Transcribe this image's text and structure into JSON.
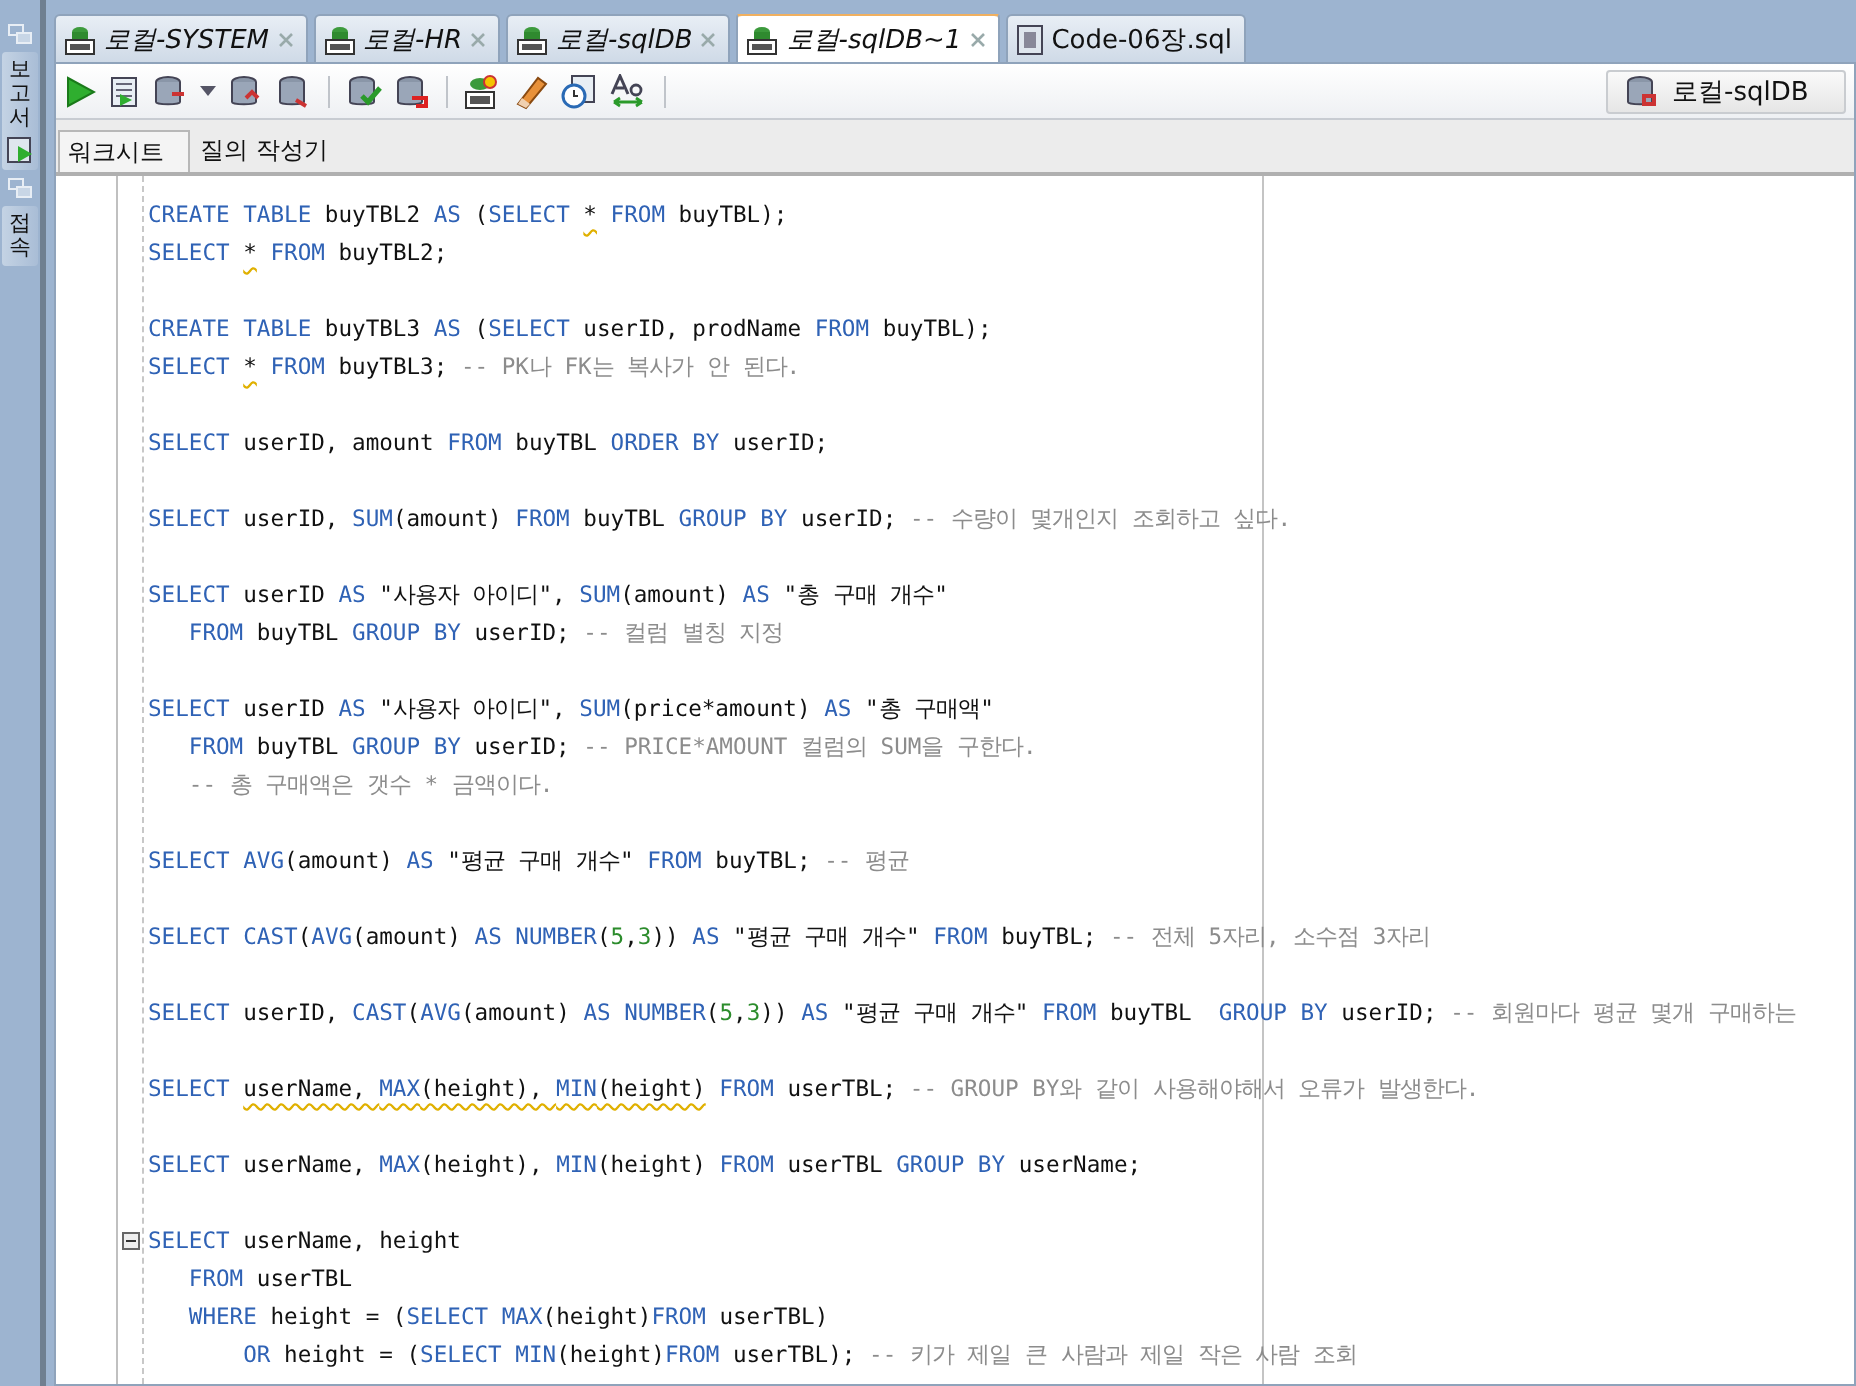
{
  "editor_tabs": [
    {
      "label": "로컬-SYSTEM",
      "selected": false,
      "kind": "worksheet"
    },
    {
      "label": "로컬-HR",
      "selected": false,
      "kind": "worksheet"
    },
    {
      "label": "로컬-sqlDB",
      "selected": false,
      "kind": "worksheet"
    },
    {
      "label": "로컬-sqlDB~1",
      "selected": true,
      "kind": "worksheet"
    },
    {
      "label": "Code-06장.sql",
      "selected": false,
      "kind": "file"
    }
  ],
  "side_tabs": [
    {
      "label": "보고서"
    },
    {
      "label": "접속"
    }
  ],
  "connection": {
    "label": "로컬-sqlDB"
  },
  "sub_tabs": [
    {
      "label": "워크시트",
      "selected": true
    },
    {
      "label": "질의 작성기",
      "selected": false
    }
  ],
  "code_lines": [
    {
      "kind": "code",
      "tokens": [
        {
          "kind": "keyword",
          "text": "CREATE TABLE"
        },
        {
          "kind": "plain",
          "text": " buyTBL2 "
        },
        {
          "kind": "keyword",
          "text": "AS"
        },
        {
          "kind": "plain",
          "text": " ("
        },
        {
          "kind": "keyword",
          "text": "SELECT "
        },
        {
          "kind": "plain",
          "text": "*",
          "squiggle": true
        },
        {
          "kind": "keyword",
          "text": " FROM"
        },
        {
          "kind": "plain",
          "text": " buyTBL);"
        }
      ]
    },
    {
      "kind": "code",
      "tokens": [
        {
          "kind": "keyword",
          "text": "SELECT "
        },
        {
          "kind": "plain",
          "text": "*",
          "squiggle": true
        },
        {
          "kind": "keyword",
          "text": " FROM"
        },
        {
          "kind": "plain",
          "text": " buyTBL2;"
        }
      ]
    },
    {
      "kind": "blank"
    },
    {
      "kind": "code",
      "tokens": [
        {
          "kind": "keyword",
          "text": "CREATE TABLE"
        },
        {
          "kind": "plain",
          "text": " buyTBL3 "
        },
        {
          "kind": "keyword",
          "text": "AS"
        },
        {
          "kind": "plain",
          "text": " ("
        },
        {
          "kind": "keyword",
          "text": "SELECT"
        },
        {
          "kind": "plain",
          "text": " userID, prodName "
        },
        {
          "kind": "keyword",
          "text": "FROM"
        },
        {
          "kind": "plain",
          "text": " buyTBL);"
        }
      ]
    },
    {
      "kind": "code",
      "tokens": [
        {
          "kind": "keyword",
          "text": "SELECT "
        },
        {
          "kind": "plain",
          "text": "*",
          "squiggle": true
        },
        {
          "kind": "keyword",
          "text": " FROM"
        },
        {
          "kind": "plain",
          "text": " buyTBL3; "
        },
        {
          "kind": "comment",
          "text": "-- PK나 FK는 복사가 안 된다."
        }
      ]
    },
    {
      "kind": "blank"
    },
    {
      "kind": "code",
      "tokens": [
        {
          "kind": "keyword",
          "text": "SELECT"
        },
        {
          "kind": "plain",
          "text": " userID, amount "
        },
        {
          "kind": "keyword",
          "text": "FROM"
        },
        {
          "kind": "plain",
          "text": " buyTBL "
        },
        {
          "kind": "keyword",
          "text": "ORDER BY"
        },
        {
          "kind": "plain",
          "text": " userID;"
        }
      ]
    },
    {
      "kind": "blank"
    },
    {
      "kind": "code",
      "tokens": [
        {
          "kind": "keyword",
          "text": "SELECT"
        },
        {
          "kind": "plain",
          "text": " userID, "
        },
        {
          "kind": "keyword",
          "text": "SUM"
        },
        {
          "kind": "plain",
          "text": "(amount) "
        },
        {
          "kind": "keyword",
          "text": "FROM"
        },
        {
          "kind": "plain",
          "text": " buyTBL "
        },
        {
          "kind": "keyword",
          "text": "GROUP BY"
        },
        {
          "kind": "plain",
          "text": " userID; "
        },
        {
          "kind": "comment",
          "text": "-- 수량이 몇개인지 조회하고 싶다."
        }
      ]
    },
    {
      "kind": "blank"
    },
    {
      "kind": "code",
      "tokens": [
        {
          "kind": "keyword",
          "text": "SELECT"
        },
        {
          "kind": "plain",
          "text": " userID "
        },
        {
          "kind": "keyword",
          "text": "AS"
        },
        {
          "kind": "plain",
          "text": " \"사용자 아이디\", "
        },
        {
          "kind": "keyword",
          "text": "SUM"
        },
        {
          "kind": "plain",
          "text": "(amount) "
        },
        {
          "kind": "keyword",
          "text": "AS"
        },
        {
          "kind": "plain",
          "text": " \"총 구매 개수\""
        }
      ]
    },
    {
      "kind": "code",
      "tokens": [
        {
          "kind": "keyword",
          "text": "   FROM"
        },
        {
          "kind": "plain",
          "text": " buyTBL "
        },
        {
          "kind": "keyword",
          "text": "GROUP BY"
        },
        {
          "kind": "plain",
          "text": " userID; "
        },
        {
          "kind": "comment",
          "text": "-- 컬럼 별칭 지정"
        }
      ]
    },
    {
      "kind": "blank"
    },
    {
      "kind": "code",
      "tokens": [
        {
          "kind": "keyword",
          "text": "SELECT"
        },
        {
          "kind": "plain",
          "text": " userID "
        },
        {
          "kind": "keyword",
          "text": "AS"
        },
        {
          "kind": "plain",
          "text": " \"사용자 아이디\", "
        },
        {
          "kind": "keyword",
          "text": "SUM"
        },
        {
          "kind": "plain",
          "text": "(price*amount) "
        },
        {
          "kind": "keyword",
          "text": "AS"
        },
        {
          "kind": "plain",
          "text": " \"총 구매액\""
        }
      ]
    },
    {
      "kind": "code",
      "tokens": [
        {
          "kind": "keyword",
          "text": "   FROM"
        },
        {
          "kind": "plain",
          "text": " buyTBL "
        },
        {
          "kind": "keyword",
          "text": "GROUP BY"
        },
        {
          "kind": "plain",
          "text": " userID; "
        },
        {
          "kind": "comment",
          "text": "-- PRICE*AMOUNT 컬럼의 SUM을 구한다."
        }
      ]
    },
    {
      "kind": "code",
      "tokens": [
        {
          "kind": "comment",
          "text": "   -- 총 구매액은 갯수 * 금액이다."
        }
      ]
    },
    {
      "kind": "blank"
    },
    {
      "kind": "code",
      "tokens": [
        {
          "kind": "keyword",
          "text": "SELECT AVG"
        },
        {
          "kind": "plain",
          "text": "(amount) "
        },
        {
          "kind": "keyword",
          "text": "AS"
        },
        {
          "kind": "plain",
          "text": " \"평균 구매 개수\" "
        },
        {
          "kind": "keyword",
          "text": "FROM"
        },
        {
          "kind": "plain",
          "text": " buyTBL; "
        },
        {
          "kind": "comment",
          "text": "-- 평균"
        }
      ]
    },
    {
      "kind": "blank"
    },
    {
      "kind": "code",
      "tokens": [
        {
          "kind": "keyword",
          "text": "SELECT CAST"
        },
        {
          "kind": "plain",
          "text": "("
        },
        {
          "kind": "keyword",
          "text": "AVG"
        },
        {
          "kind": "plain",
          "text": "(amount) "
        },
        {
          "kind": "keyword",
          "text": "AS NUMBER"
        },
        {
          "kind": "plain",
          "text": "("
        },
        {
          "kind": "number",
          "text": "5"
        },
        {
          "kind": "plain",
          "text": ","
        },
        {
          "kind": "number",
          "text": "3"
        },
        {
          "kind": "plain",
          "text": ")) "
        },
        {
          "kind": "keyword",
          "text": "AS"
        },
        {
          "kind": "plain",
          "text": " \"평균 구매 개수\" "
        },
        {
          "kind": "keyword",
          "text": "FROM"
        },
        {
          "kind": "plain",
          "text": " buyTBL; "
        },
        {
          "kind": "comment",
          "text": "-- 전체 5자리, 소수점 3자리"
        }
      ]
    },
    {
      "kind": "blank"
    },
    {
      "kind": "code",
      "tokens": [
        {
          "kind": "keyword",
          "text": "SELECT"
        },
        {
          "kind": "plain",
          "text": " userID, "
        },
        {
          "kind": "keyword",
          "text": "CAST"
        },
        {
          "kind": "plain",
          "text": "("
        },
        {
          "kind": "keyword",
          "text": "AVG"
        },
        {
          "kind": "plain",
          "text": "(amount) "
        },
        {
          "kind": "keyword",
          "text": "AS NUMBER"
        },
        {
          "kind": "plain",
          "text": "("
        },
        {
          "kind": "number",
          "text": "5"
        },
        {
          "kind": "plain",
          "text": ","
        },
        {
          "kind": "number",
          "text": "3"
        },
        {
          "kind": "plain",
          "text": ")) "
        },
        {
          "kind": "keyword",
          "text": "AS"
        },
        {
          "kind": "plain",
          "text": " \"평균 구매 개수\" "
        },
        {
          "kind": "keyword",
          "text": "FROM"
        },
        {
          "kind": "plain",
          "text": " buyTBL  "
        },
        {
          "kind": "keyword",
          "text": "GROUP BY"
        },
        {
          "kind": "plain",
          "text": " userID; "
        },
        {
          "kind": "comment",
          "text": "-- 회원마다 평균 몇개 구매하는"
        }
      ]
    },
    {
      "kind": "blank"
    },
    {
      "kind": "code",
      "tokens": [
        {
          "kind": "keyword",
          "text": "SELECT "
        },
        {
          "kind": "plain",
          "text": "userName, ",
          "squiggle": true
        },
        {
          "kind": "keyword",
          "text": "MAX",
          "squiggle": true
        },
        {
          "kind": "plain",
          "text": "(height), ",
          "squiggle": true
        },
        {
          "kind": "keyword",
          "text": "MIN",
          "squiggle": true
        },
        {
          "kind": "plain",
          "text": "(height)",
          "squiggle": true
        },
        {
          "kind": "keyword",
          "text": " FROM"
        },
        {
          "kind": "plain",
          "text": " userTBL; "
        },
        {
          "kind": "comment",
          "text": "-- GROUP BY와 같이 사용해야해서 오류가 발생한다."
        }
      ]
    },
    {
      "kind": "blank"
    },
    {
      "kind": "code",
      "tokens": [
        {
          "kind": "keyword",
          "text": "SELECT"
        },
        {
          "kind": "plain",
          "text": " userName, "
        },
        {
          "kind": "keyword",
          "text": "MAX"
        },
        {
          "kind": "plain",
          "text": "(height), "
        },
        {
          "kind": "keyword",
          "text": "MIN"
        },
        {
          "kind": "plain",
          "text": "(height) "
        },
        {
          "kind": "keyword",
          "text": "FROM"
        },
        {
          "kind": "plain",
          "text": " userTBL "
        },
        {
          "kind": "keyword",
          "text": "GROUP BY"
        },
        {
          "kind": "plain",
          "text": " userName;"
        }
      ]
    },
    {
      "kind": "blank"
    },
    {
      "kind": "code",
      "fold": true,
      "tokens": [
        {
          "kind": "keyword",
          "text": "SELECT"
        },
        {
          "kind": "plain",
          "text": " userName, height"
        }
      ]
    },
    {
      "kind": "code",
      "tokens": [
        {
          "kind": "keyword",
          "text": "   FROM"
        },
        {
          "kind": "plain",
          "text": " userTBL"
        }
      ]
    },
    {
      "kind": "code",
      "tokens": [
        {
          "kind": "keyword",
          "text": "   WHERE"
        },
        {
          "kind": "plain",
          "text": " height = ("
        },
        {
          "kind": "keyword",
          "text": "SELECT MAX"
        },
        {
          "kind": "plain",
          "text": "(height)"
        },
        {
          "kind": "keyword",
          "text": "FROM"
        },
        {
          "kind": "plain",
          "text": " userTBL)"
        }
      ]
    },
    {
      "kind": "code",
      "tokens": [
        {
          "kind": "keyword",
          "text": "       OR"
        },
        {
          "kind": "plain",
          "text": " height = ("
        },
        {
          "kind": "keyword",
          "text": "SELECT MIN"
        },
        {
          "kind": "plain",
          "text": "(height)"
        },
        {
          "kind": "keyword",
          "text": "FROM"
        },
        {
          "kind": "plain",
          "text": " userTBL); "
        },
        {
          "kind": "comment",
          "text": "-- 키가 제일 큰 사람과 제일 작은 사람 조회"
        }
      ]
    }
  ]
}
